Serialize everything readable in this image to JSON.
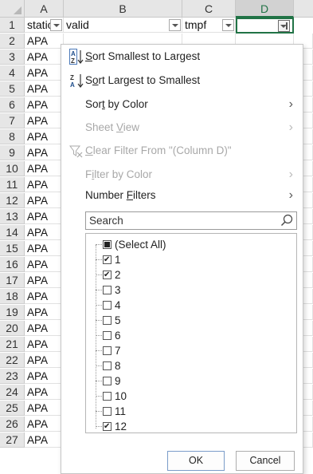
{
  "columns": [
    {
      "letter": "A",
      "header": "station",
      "has_filter": true
    },
    {
      "letter": "B",
      "header": "valid",
      "has_filter": true
    },
    {
      "letter": "C",
      "header": "tmpf",
      "has_filter": true
    },
    {
      "letter": "D",
      "header": "",
      "has_filter": true,
      "filter_active": true
    }
  ],
  "rows": [
    {
      "num": "1"
    },
    {
      "num": "2",
      "a": "APA"
    },
    {
      "num": "3",
      "a": "APA"
    },
    {
      "num": "4",
      "a": "APA"
    },
    {
      "num": "5",
      "a": "APA"
    },
    {
      "num": "6",
      "a": "APA"
    },
    {
      "num": "7",
      "a": "APA"
    },
    {
      "num": "8",
      "a": "APA"
    },
    {
      "num": "9",
      "a": "APA"
    },
    {
      "num": "10",
      "a": "APA"
    },
    {
      "num": "11",
      "a": "APA"
    },
    {
      "num": "12",
      "a": "APA"
    },
    {
      "num": "13",
      "a": "APA"
    },
    {
      "num": "14",
      "a": "APA"
    },
    {
      "num": "15",
      "a": "APA"
    },
    {
      "num": "16",
      "a": "APA"
    },
    {
      "num": "17",
      "a": "APA"
    },
    {
      "num": "18",
      "a": "APA"
    },
    {
      "num": "19",
      "a": "APA"
    },
    {
      "num": "20",
      "a": "APA"
    },
    {
      "num": "21",
      "a": "APA"
    },
    {
      "num": "22",
      "a": "APA"
    },
    {
      "num": "23",
      "a": "APA"
    },
    {
      "num": "24",
      "a": "APA"
    },
    {
      "num": "25",
      "a": "APA"
    },
    {
      "num": "26",
      "a": "APA"
    },
    {
      "num": "27",
      "a": "APA"
    }
  ],
  "menu": {
    "sort_asc": {
      "pre": "",
      "u": "S",
      "post": "ort Smallest to Largest",
      "icon": "sort-ascending-icon"
    },
    "sort_desc": {
      "pre": "S",
      "u": "o",
      "post": "rt Largest to Smallest",
      "icon": "sort-descending-icon"
    },
    "sort_by_color": {
      "pre": "Sor",
      "u": "t",
      "post": " by Color"
    },
    "sheet_view": {
      "pre": "Sheet ",
      "u": "V",
      "post": "iew"
    },
    "clear_filter": {
      "pre": "",
      "u": "C",
      "post": "lear Filter From \"(Column D)\"",
      "icon": "clear-filter-icon"
    },
    "filter_by_color": {
      "pre": "F",
      "u": "i",
      "post": "lter by Color"
    },
    "number_filters": {
      "pre": "Number ",
      "u": "F",
      "post": "ilters"
    },
    "search_placeholder": "Search",
    "values": [
      {
        "label": "(Select All)",
        "state": "partial"
      },
      {
        "label": "1",
        "state": "checked"
      },
      {
        "label": "2",
        "state": "checked"
      },
      {
        "label": "3",
        "state": "unchecked"
      },
      {
        "label": "4",
        "state": "unchecked"
      },
      {
        "label": "5",
        "state": "unchecked"
      },
      {
        "label": "6",
        "state": "unchecked"
      },
      {
        "label": "7",
        "state": "unchecked"
      },
      {
        "label": "8",
        "state": "unchecked"
      },
      {
        "label": "9",
        "state": "unchecked"
      },
      {
        "label": "10",
        "state": "unchecked"
      },
      {
        "label": "11",
        "state": "unchecked"
      },
      {
        "label": "12",
        "state": "checked"
      }
    ],
    "ok_label": "OK",
    "cancel_label": "Cancel"
  },
  "colors": {
    "accent": "#217346",
    "header_bg": "#e6e6e6"
  }
}
